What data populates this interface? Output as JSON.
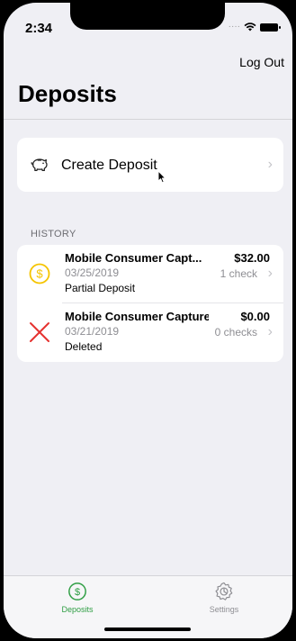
{
  "status_bar": {
    "time": "2:34"
  },
  "header": {
    "logout_label": "Log Out",
    "title": "Deposits"
  },
  "create_deposit": {
    "label": "Create Deposit",
    "icon": "piggy-bank-icon"
  },
  "history": {
    "header": "HISTORY",
    "items": [
      {
        "title": "Mobile Consumer Capt...",
        "date": "03/25/2019",
        "status": "Partial Deposit",
        "amount": "$32.00",
        "checks": "1 check",
        "icon": "dollar-coin-icon",
        "icon_color": "#f5c400"
      },
      {
        "title": "Mobile Consumer Capture",
        "date": "03/21/2019",
        "status": "Deleted",
        "amount": "$0.00",
        "checks": "0 checks",
        "icon": "x-mark-icon",
        "icon_color": "#e5322f"
      }
    ]
  },
  "tabbar": {
    "tabs": [
      {
        "label": "Deposits",
        "icon": "dollar-circle-icon",
        "active": true,
        "color": "#2f9e44"
      },
      {
        "label": "Settings",
        "icon": "gear-icon",
        "active": false,
        "color": "#8e8e93"
      }
    ]
  }
}
